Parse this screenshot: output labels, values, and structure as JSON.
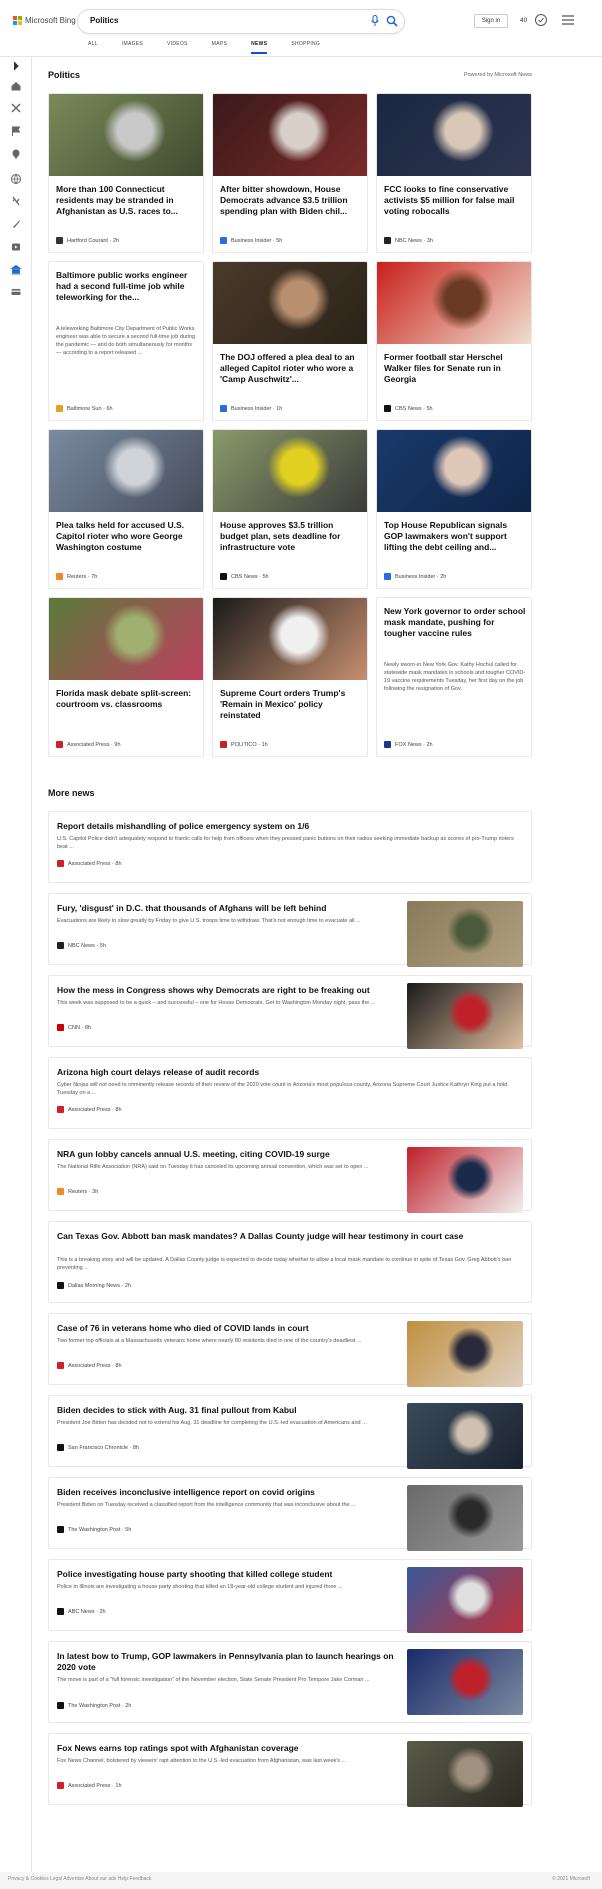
{
  "header": {
    "logo_text": "Microsoft Bing",
    "search_value": "Politics",
    "signin_label": "Sign in",
    "points": "40",
    "tabs": [
      {
        "label": "ALL",
        "active": false
      },
      {
        "label": "IMAGES",
        "active": false
      },
      {
        "label": "VIDEOS",
        "active": false
      },
      {
        "label": "MAPS",
        "active": false
      },
      {
        "label": "NEWS",
        "active": true
      },
      {
        "label": "SHOPPING",
        "active": false
      }
    ]
  },
  "colors": {
    "accent": "#174ae4",
    "logo": [
      "#f25022",
      "#7fba00",
      "#00a4ef",
      "#ffb900"
    ]
  },
  "rail_icons": [
    "chevron-right-icon",
    "home-icon",
    "sports-icon",
    "flag-icon",
    "location-icon",
    "globe-icon",
    "science-icon",
    "rocket-icon",
    "entertainment-icon",
    "bank-icon",
    "money-icon"
  ],
  "section": {
    "title": "Politics",
    "powered_by": "Powered by Microsoft News"
  },
  "cards": [
    {
      "title": "More than 100 Connecticut residents may be stranded in Afghanistan as U.S. races to...",
      "source": "Hartford Courant",
      "time": "2h",
      "src_icon": "hc-icon",
      "src_color": "#333",
      "img_colors": [
        "#7a8a5a",
        "#c9c9c9",
        "#3f4a2e"
      ],
      "snippet": ""
    },
    {
      "title": "After bitter showdown, House Democrats advance $3.5 trillion spending plan with Biden chil...",
      "source": "Business Insider",
      "time": "5h",
      "src_icon": "bi-icon",
      "src_color": "#2a6be0",
      "img_colors": [
        "#3a1a1a",
        "#d8cfc8",
        "#7a2a2a"
      ],
      "snippet": ""
    },
    {
      "title": "FCC looks to fine conservative activists $5 million for false mail voting robocalls",
      "source": "NBC News",
      "time": "3h",
      "src_icon": "nbc-icon",
      "src_color": "#222",
      "img_colors": [
        "#1b2740",
        "#d9c7b8",
        "#2d3550"
      ],
      "snippet": ""
    },
    {
      "title": "Baltimore public works engineer had a second full-time job while teleworking for the...",
      "source": "Baltimore Sun",
      "time": "6h",
      "src_icon": "bs-icon",
      "src_color": "#e0a520",
      "img_colors": [],
      "snippet": "A teleworking Baltimore City Department of Public Works engineer was able to secure a second full-time job during the pandemic — and do both simultaneously for months — according to a report released ..."
    },
    {
      "title": "The DOJ offered a plea deal to an alleged Capitol rioter who wore a 'Camp Auschwitz'...",
      "source": "Business Insider",
      "time": "1h",
      "src_icon": "bi-icon",
      "src_color": "#2a6be0",
      "img_colors": [
        "#4a3a2a",
        "#b89070",
        "#2a2218"
      ],
      "snippet": ""
    },
    {
      "title": "Former football star Herschel Walker files for Senate run in Georgia",
      "source": "CBS News",
      "time": "5h",
      "src_icon": "cbs-icon",
      "src_color": "#111",
      "img_colors": [
        "#c8201a",
        "#6b3a22",
        "#f0e0d0"
      ],
      "snippet": ""
    },
    {
      "title": "Plea talks held for accused U.S. Capitol rioter who wore George Washington costume",
      "source": "Reuters",
      "time": "7h",
      "src_icon": "reuters-icon",
      "src_color": "#f08a24",
      "img_colors": [
        "#7a8aa0",
        "#cfd4da",
        "#444c5a"
      ],
      "snippet": ""
    },
    {
      "title": "House approves $3.5 trillion budget plan, sets deadline for infrastructure vote",
      "source": "CBS News",
      "time": "5h",
      "src_icon": "cbs-icon",
      "src_color": "#111",
      "img_colors": [
        "#8a9a6a",
        "#e0d020",
        "#3a3a3a"
      ],
      "snippet": ""
    },
    {
      "title": "Top House Republican signals GOP lawmakers won't support lifting the debt ceiling and...",
      "source": "Business Insider",
      "time": "2h",
      "src_icon": "bi-icon",
      "src_color": "#2a6be0",
      "img_colors": [
        "#1a3a6a",
        "#e0c8b8",
        "#0e2448"
      ],
      "snippet": ""
    },
    {
      "title": "Florida mask debate split-screen: courtroom vs. classrooms",
      "source": "Associated Press",
      "time": "9h",
      "src_icon": "ap-icon",
      "src_color": "#d0202a",
      "img_colors": [
        "#5a7a3a",
        "#a0b070",
        "#c04060"
      ],
      "snippet": ""
    },
    {
      "title": "Supreme Court orders Trump's 'Remain in Mexico' policy reinstated",
      "source": "POLITICO",
      "time": "1h",
      "src_icon": "politico-icon",
      "src_color": "#c8202a",
      "img_colors": [
        "#1a1a1a",
        "#f0f0f0",
        "#c89070"
      ],
      "snippet": ""
    },
    {
      "title": "New York governor to order school mask mandate, pushing for tougher vaccine rules",
      "source": "FOX News",
      "time": "2h",
      "src_icon": "fox-icon",
      "src_color": "#1a3a8a",
      "img_colors": [],
      "snippet": "Newly sworn-in New York Gov. Kathy Hochul called for statewide mask mandates in schools and tougher COVID-19 vaccine requirements Tuesday, her first day on the job following the resignation of Gov."
    }
  ],
  "more_news": {
    "title": "More news",
    "items": [
      {
        "title": "Report details mishandling of police emergency system on 1/6",
        "snippet": "U.S. Capitol Police didn't adequately respond to frantic calls for help from officers when they pressed panic buttons on their radios seeking immediate backup as scores of pro-Trump rioters beat ...",
        "source": "Associated Press",
        "time": "8h",
        "src_icon": "ap-icon",
        "src_color": "#d0202a",
        "has_thumb": false,
        "thumb_colors": []
      },
      {
        "title": "Fury, 'disgust' in D.C. that thousands of Afghans will be left behind",
        "snippet": "Evacuations are likely to slow greatly by Friday to give U.S. troops time to withdraw. That's not enough time to evacuate all ...",
        "source": "NBC News",
        "time": "5h",
        "src_icon": "nbc-icon",
        "src_color": "#222",
        "has_thumb": true,
        "thumb_colors": [
          "#8a7a5a",
          "#4a5a3a",
          "#b0a080"
        ]
      },
      {
        "title": "How the mess in Congress shows why Democrats are right to be freaking out",
        "snippet": "This week was supposed to be a quick – and successful – one for House Democrats. Get to Washington Monday night, pass the ...",
        "source": "CNN",
        "time": "8h",
        "src_icon": "cnn-icon",
        "src_color": "#cc0000",
        "has_thumb": true,
        "thumb_colors": [
          "#1a1a1a",
          "#c0202a",
          "#e0c0a0"
        ]
      },
      {
        "title": "Arizona high court delays release of audit records",
        "snippet": "Cyber Ninjas will not need to imminently release records of their review of the 2020 vote count in Arizona's most populous county, Arizona Supreme Court Justice Kathryn King put a hold Tuesday on a ...",
        "source": "Associated Press",
        "time": "8h",
        "src_icon": "ap-icon",
        "src_color": "#d0202a",
        "has_thumb": false,
        "thumb_colors": []
      },
      {
        "title": "NRA gun lobby cancels annual U.S. meeting, citing COVID-19 surge",
        "snippet": "The National Rifle Association (NRA) said on Tuesday it has canceled its upcoming annual convention, which was set to open ...",
        "source": "Reuters",
        "time": "3h",
        "src_icon": "reuters-icon",
        "src_color": "#f08a24",
        "has_thumb": true,
        "thumb_colors": [
          "#c0202a",
          "#1a2a4a",
          "#f0f0f0"
        ]
      },
      {
        "title": "Can Texas Gov. Abbott ban mask mandates? A Dallas County judge will hear testimony in court case",
        "snippet": "This is a breaking story and will be updated. A Dallas County judge is expected to decide today whether to allow a local mask mandate to continue in spite of Texas Gov. Greg Abbott's ban preventing ...",
        "source": "Dallas Morning News",
        "time": "2h",
        "src_icon": "dmn-icon",
        "src_color": "#111",
        "has_thumb": false,
        "thumb_colors": []
      },
      {
        "title": "Case of 76 in veterans home who died of COVID lands in court",
        "snippet": "Two former top officials at a Massachusetts veterans home where nearly 80 residents died in one of the country's deadliest ...",
        "source": "Associated Press",
        "time": "8h",
        "src_icon": "ap-icon",
        "src_color": "#d0202a",
        "has_thumb": true,
        "thumb_colors": [
          "#c09040",
          "#2a2a3a",
          "#e0d0c0"
        ]
      },
      {
        "title": "Biden decides to stick with Aug. 31 final pullout from Kabul",
        "snippet": "President Joe Biden has decided not to extend his Aug. 31 deadline for completing the U.S.-led evacuation of Americans and ...",
        "source": "San Francisco Chronicle",
        "time": "8h",
        "src_icon": "sfc-icon",
        "src_color": "#111",
        "has_thumb": true,
        "thumb_colors": [
          "#3a4a5a",
          "#d0c0b0",
          "#1a2230"
        ]
      },
      {
        "title": "Biden receives inconclusive intelligence report on covid origins",
        "snippet": "President Biden on Tuesday received a classified report from the intelligence community that was inconclusive about the ...",
        "source": "The Washington Post",
        "time": "5h",
        "src_icon": "wp-icon",
        "src_color": "#111",
        "has_thumb": true,
        "thumb_colors": [
          "#6a6a6a",
          "#2a2a2a",
          "#9a9a9a"
        ]
      },
      {
        "title": "Police investigating house party shooting that killed college student",
        "snippet": "Police in Illinois are investigating a house party shooting that killed an 18-year-old college student and injured three ...",
        "source": "ABC News",
        "time": "2h",
        "src_icon": "abc-icon",
        "src_color": "#111",
        "has_thumb": true,
        "thumb_colors": [
          "#3a5a9a",
          "#e0e0e0",
          "#c0303a"
        ]
      },
      {
        "title": "In latest bow to Trump, GOP lawmakers in Pennsylvania plan to launch hearings on 2020 vote",
        "snippet": "The move is part of a \"full forensic investigation\" of the November election, State Senate President Pro Tempore Jake Corman ...",
        "source": "The Washington Post",
        "time": "2h",
        "src_icon": "wp-icon",
        "src_color": "#111",
        "has_thumb": true,
        "thumb_colors": [
          "#1a2a6a",
          "#c0202a",
          "#7a8aa0"
        ]
      },
      {
        "title": "Fox News earns top ratings spot with Afghanistan coverage",
        "snippet": "Fox News Channel, bolstered by viewers' rapt attention to the U.S.-led evacuation from Afghanistan, was last week's ...",
        "source": "Associated Press",
        "time": "1h",
        "src_icon": "ap-icon",
        "src_color": "#d0202a",
        "has_thumb": true,
        "thumb_colors": [
          "#5a5a4a",
          "#a09080",
          "#2a2a22"
        ]
      }
    ]
  },
  "footer": {
    "left": "Privacy & Cookies   Legal   Advertise   About our ads   Help   Feedback",
    "right": "© 2021 Microsoft"
  }
}
